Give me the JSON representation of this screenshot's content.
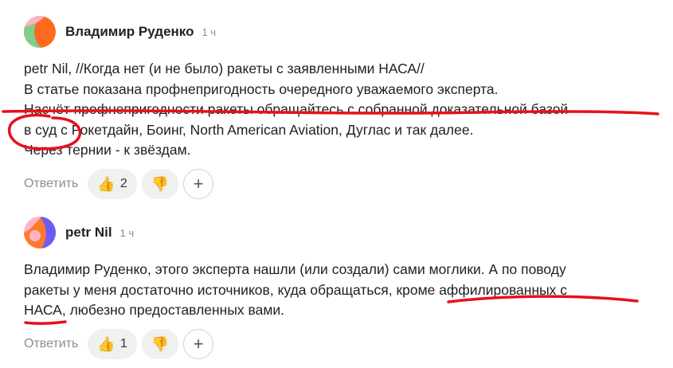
{
  "comments": [
    {
      "author": "Владимир Руденко",
      "time": "1 ч",
      "lines": [
        "petr Nil, //Когда нет (и не было) ракеты с заявленными НАСА//",
        "В статье показана профнепригодность очередного уважаемого эксперта.",
        "Насчёт профнепригодности ракеты обращайтесь с собранной доказательной базой",
        "в суд с Рокетдайн, Боинг, North American Aviation, Дуглас и так далее.",
        "Через тернии - к звёздам."
      ],
      "reply_label": "Ответить",
      "likes": "2",
      "avatar_colors": [
        "#ff6a1f",
        "#7fce8b",
        "#ffb3c7"
      ]
    },
    {
      "author": "petr Nil",
      "time": "1 ч",
      "lines": [
        "Владимир Руденко, этого эксперта нашли (или создали) сами моглики. А по поводу",
        "ракеты у меня достаточно источников, куда обращаться, кроме аффилированных с",
        "НАСА, любезно предоставленных вами."
      ],
      "reply_label": "Ответить",
      "likes": "1",
      "avatar_colors": [
        "#6c5cf6",
        "#ffb3c7",
        "#ff7a2a"
      ]
    }
  ],
  "icons": {
    "like": "thumbs-up-icon",
    "dislike": "thumbs-down-icon",
    "add": "plus-icon"
  },
  "colors": {
    "annotation": "#e8101a",
    "muted": "#8d8d8d",
    "pill": "#f0f0f0"
  },
  "plus_symbol": "+"
}
